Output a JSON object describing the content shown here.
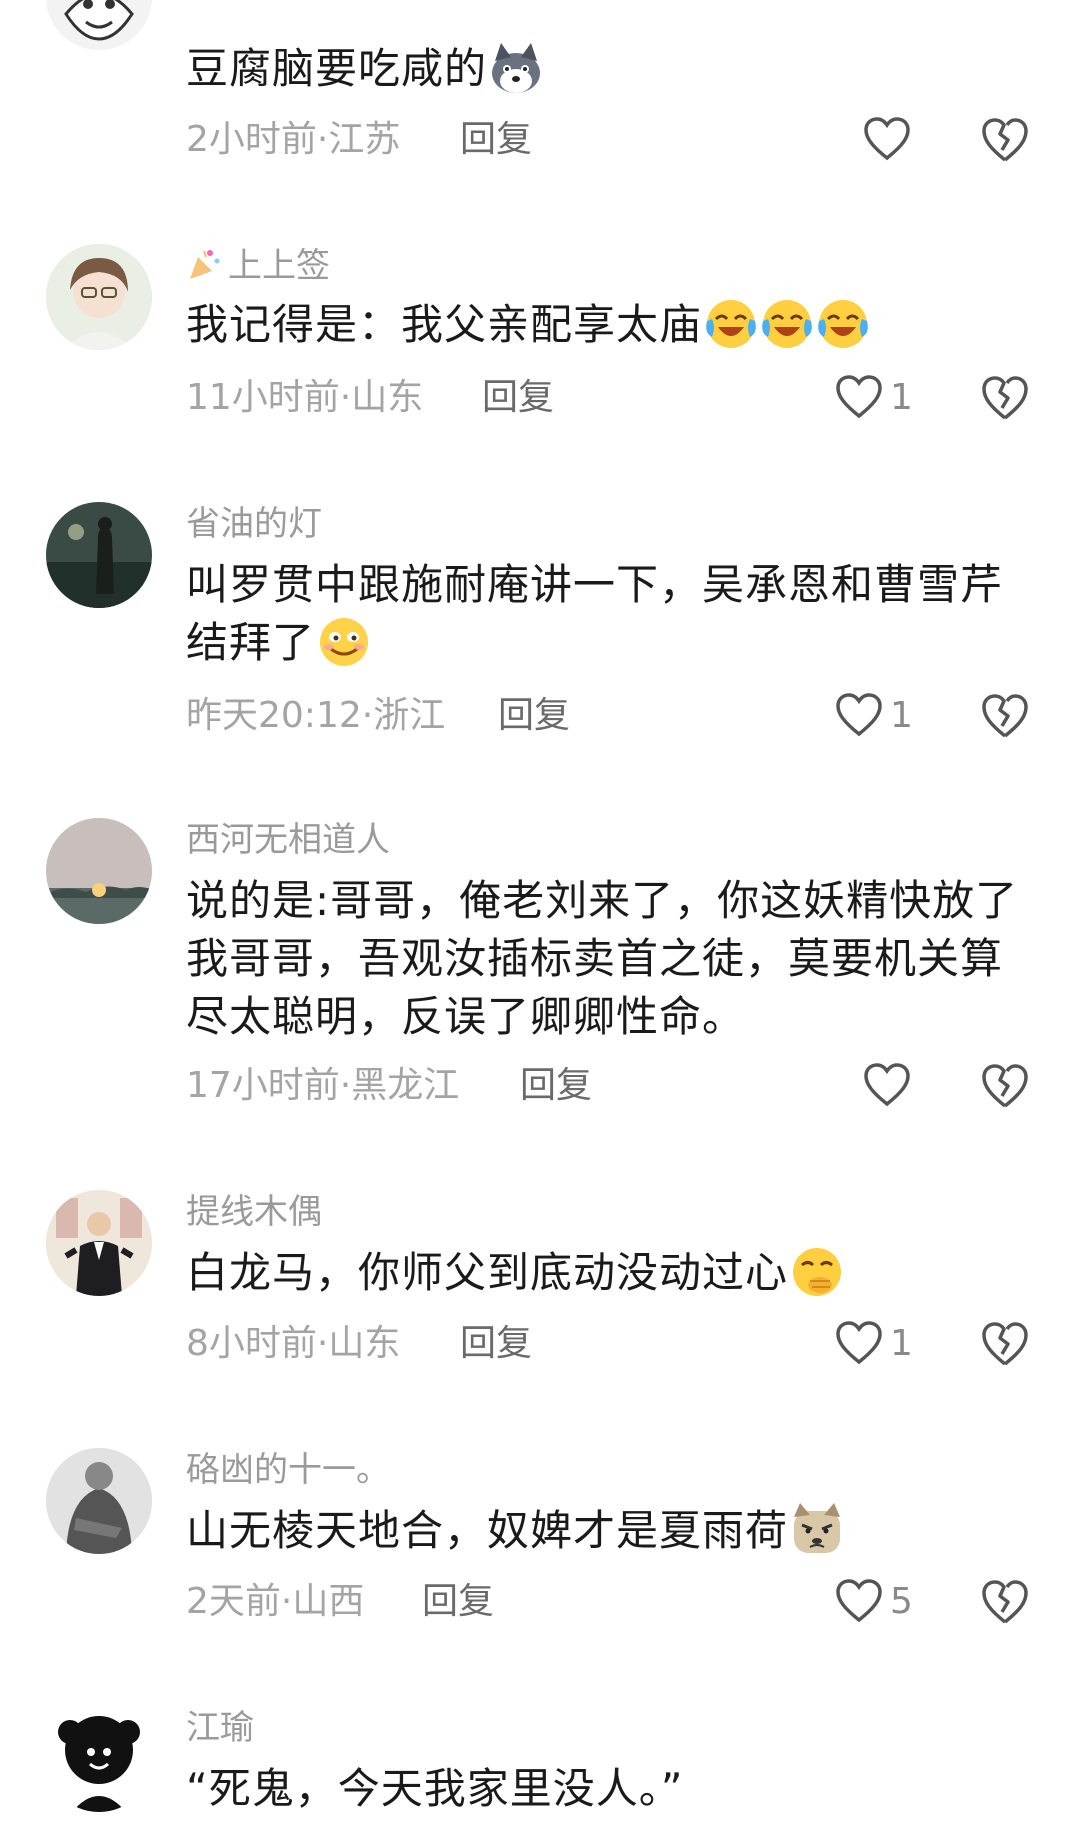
{
  "comments": [
    {
      "username": "",
      "text": "豆腐脑要吃咸的",
      "emoji": "husky-dog-emoji",
      "meta": "2小时前·江苏",
      "reply": "回复",
      "likes": ""
    },
    {
      "username": "上上签",
      "text": "我记得是：我父亲配享太庙",
      "emoji": "crying-laughing-emoji",
      "meta": "11小时前·山东",
      "reply": "回复",
      "likes": "1"
    },
    {
      "username": "省油的灯",
      "text_line1": "叫罗贯中跟施耐庵讲一下，吴承恩和曹雪芹",
      "text_line2": "结拜了",
      "emoji": "smirk-face-emoji",
      "meta": "昨天20:12·浙江",
      "reply": "回复",
      "likes": "1"
    },
    {
      "username": "西河无相道人",
      "text_line1": "说的是:哥哥，俺老刘来了，你这妖精快放了",
      "text_line2": "我哥哥，吾观汝插标卖首之徒，莫要机关算",
      "text_line3": "尽太聪明，反误了卿卿性命。",
      "meta": "17小时前·黑龙江",
      "reply": "回复",
      "likes": ""
    },
    {
      "username": "提线木偶",
      "text": "白龙马，你师父到底动没动过心",
      "emoji": "giggle-face-emoji",
      "meta": "8小时前·山东",
      "reply": "回复",
      "likes": "1"
    },
    {
      "username": "硌凼的十一。",
      "text": "山无棱天地合，奴婢才是夏雨荷",
      "emoji": "angry-dog-emoji",
      "meta": "2天前·山西",
      "reply": "回复",
      "likes": "5"
    },
    {
      "username": "江瑜",
      "text": "“死鬼，今天我家里没人。”"
    }
  ],
  "icons": {
    "like": "heart-outline-icon",
    "dislike": "broken-heart-icon"
  }
}
